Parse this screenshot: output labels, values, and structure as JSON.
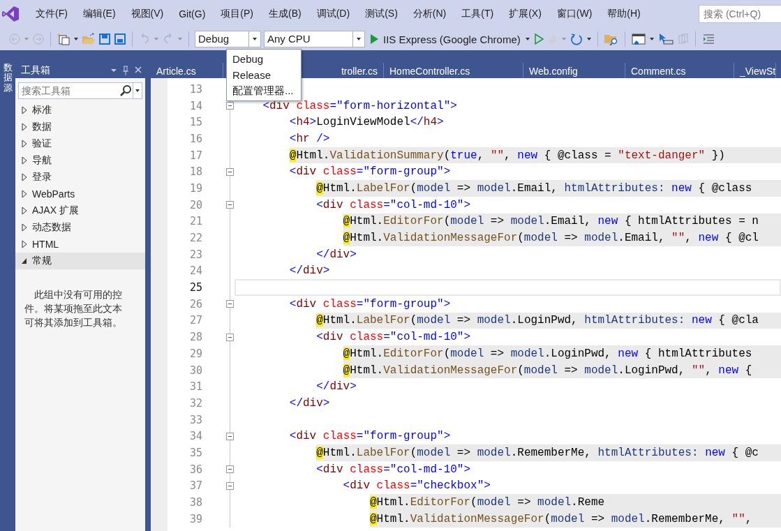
{
  "menu_bar": {
    "items": [
      "文件(F)",
      "编辑(E)",
      "视图(V)",
      "Git(G)",
      "项目(P)",
      "生成(B)",
      "调试(D)",
      "测试(S)",
      "分析(N)",
      "工具(T)",
      "扩展(X)",
      "窗口(W)",
      "帮助(H)"
    ],
    "search": {
      "placeholder": "搜索 (Ctrl+Q)"
    }
  },
  "toolbar": {
    "config_combo": {
      "value": "Debug"
    },
    "platform_combo": {
      "value": "Any CPU"
    },
    "run_button": {
      "label": "IIS Express (Google Chrome)"
    }
  },
  "config_menu": {
    "items": [
      "Debug",
      "Release",
      "配置管理器..."
    ]
  },
  "side_tab": {
    "label": "数据源"
  },
  "toolbox": {
    "title": "工具箱",
    "search": {
      "placeholder": "搜索工具箱"
    },
    "groups": [
      {
        "label": "标准",
        "expanded": false,
        "selected": false
      },
      {
        "label": "数据",
        "expanded": false,
        "selected": false
      },
      {
        "label": "验证",
        "expanded": false,
        "selected": false
      },
      {
        "label": "导航",
        "expanded": false,
        "selected": false
      },
      {
        "label": "登录",
        "expanded": false,
        "selected": false
      },
      {
        "label": "WebParts",
        "expanded": false,
        "selected": false
      },
      {
        "label": "AJAX 扩展",
        "expanded": false,
        "selected": false
      },
      {
        "label": "动态数据",
        "expanded": false,
        "selected": false
      },
      {
        "label": "HTML",
        "expanded": false,
        "selected": false
      },
      {
        "label": "常规",
        "expanded": true,
        "selected": true
      }
    ],
    "empty_note": "此组中没有可用的控件。将某项拖至此文本可将其添加到工具箱。"
  },
  "tabs": [
    "Article.cs",
    "troller.cs",
    "HomeController.cs",
    "Web.config",
    "Comment.cs",
    "_ViewSt"
  ],
  "editor": {
    "lines": [
      {
        "number": "13",
        "fold": false,
        "current": false
      },
      {
        "number": "14",
        "fold": true,
        "current": false,
        "razor": false,
        "tokens": [
          {
            "kind": "punct",
            "text": "<"
          },
          {
            "kind": "tag",
            "text": "div"
          },
          {
            "kind": "attr",
            "text": " class"
          },
          {
            "kind": "punct",
            "text": "="
          },
          {
            "kind": "value",
            "text": "\"form-horizontal\""
          },
          {
            "kind": "punct",
            "text": ">"
          }
        ],
        "children": [
          {
            "number": "15",
            "fold": false,
            "current": false,
            "razor": false,
            "tokens": [
              {
                "kind": "punct",
                "text": "<"
              },
              {
                "kind": "tag",
                "text": "h4"
              },
              {
                "kind": "punct",
                "text": ">"
              },
              {
                "kind": "text",
                "text": "LoginViewModel"
              },
              {
                "kind": "punct",
                "text": "</"
              },
              {
                "kind": "tag",
                "text": "h4"
              },
              {
                "kind": "punct",
                "text": ">"
              }
            ]
          },
          {
            "number": "16",
            "fold": false,
            "current": false,
            "razor": false,
            "tokens": [
              {
                "kind": "punct",
                "text": "<"
              },
              {
                "kind": "tag",
                "text": "hr"
              },
              {
                "kind": "punct",
                "text": " />"
              }
            ]
          },
          {
            "number": "17",
            "fold": false,
            "current": false,
            "razor": true,
            "tokens": [
              {
                "kind": "at",
                "text": "@"
              },
              {
                "kind": "text",
                "text": "Html."
              },
              {
                "kind": "method",
                "text": "ValidationSummary"
              },
              {
                "kind": "text",
                "text": "("
              },
              {
                "kind": "kw",
                "text": "true"
              },
              {
                "kind": "text",
                "text": ", "
              },
              {
                "kind": "str",
                "text": "\"\""
              },
              {
                "kind": "text",
                "text": ", "
              },
              {
                "kind": "kw",
                "text": "new"
              },
              {
                "kind": "text",
                "text": " { @class = "
              },
              {
                "kind": "str",
                "text": "\"text-danger\""
              },
              {
                "kind": "text",
                "text": " })"
              }
            ]
          },
          {
            "number": "18",
            "fold": true,
            "current": false,
            "razor": false,
            "tokens": [
              {
                "kind": "punct",
                "text": "<"
              },
              {
                "kind": "tag",
                "text": "div"
              },
              {
                "kind": "attr",
                "text": " class"
              },
              {
                "kind": "punct",
                "text": "="
              },
              {
                "kind": "value",
                "text": "\"form-group\""
              },
              {
                "kind": "punct",
                "text": ">"
              }
            ],
            "children": [
              {
                "number": "19",
                "fold": false,
                "current": false,
                "razor": true,
                "tokens": [
                  {
                    "kind": "at",
                    "text": "@"
                  },
                  {
                    "kind": "text",
                    "text": "Html."
                  },
                  {
                    "kind": "method",
                    "text": "LabelFor"
                  },
                  {
                    "kind": "text",
                    "text": "("
                  },
                  {
                    "kind": "var",
                    "text": "model"
                  },
                  {
                    "kind": "text",
                    "text": " => "
                  },
                  {
                    "kind": "var",
                    "text": "model"
                  },
                  {
                    "kind": "text",
                    "text": ".Email, "
                  },
                  {
                    "kind": "var",
                    "text": "htmlAttributes:"
                  },
                  {
                    "kind": "kw",
                    "text": " new"
                  },
                  {
                    "kind": "text",
                    "text": " { @class"
                  }
                ]
              },
              {
                "number": "20",
                "fold": true,
                "current": false,
                "razor": false,
                "tokens": [
                  {
                    "kind": "punct",
                    "text": "<"
                  },
                  {
                    "kind": "tag",
                    "text": "div"
                  },
                  {
                    "kind": "attr",
                    "text": " class"
                  },
                  {
                    "kind": "punct",
                    "text": "="
                  },
                  {
                    "kind": "value",
                    "text": "\"col-md-10\""
                  },
                  {
                    "kind": "punct",
                    "text": ">"
                  }
                ],
                "children": [
                  {
                    "number": "21",
                    "fold": false,
                    "current": false,
                    "razor": true,
                    "tokens": [
                      {
                        "kind": "at",
                        "text": "@"
                      },
                      {
                        "kind": "text",
                        "text": "Html."
                      },
                      {
                        "kind": "method",
                        "text": "EditorFor"
                      },
                      {
                        "kind": "text",
                        "text": "("
                      },
                      {
                        "kind": "var",
                        "text": "model"
                      },
                      {
                        "kind": "text",
                        "text": " => "
                      },
                      {
                        "kind": "var",
                        "text": "model"
                      },
                      {
                        "kind": "text",
                        "text": ".Email, "
                      },
                      {
                        "kind": "kw",
                        "text": "new"
                      },
                      {
                        "kind": "text",
                        "text": " { htmlAttributes = n"
                      }
                    ]
                  },
                  {
                    "number": "22",
                    "fold": false,
                    "current": false,
                    "razor": true,
                    "tokens": [
                      {
                        "kind": "at",
                        "text": "@"
                      },
                      {
                        "kind": "text",
                        "text": "Html."
                      },
                      {
                        "kind": "method",
                        "text": "ValidationMessageFor"
                      },
                      {
                        "kind": "text",
                        "text": "("
                      },
                      {
                        "kind": "var",
                        "text": "model"
                      },
                      {
                        "kind": "text",
                        "text": " => "
                      },
                      {
                        "kind": "var",
                        "text": "model"
                      },
                      {
                        "kind": "text",
                        "text": ".Email, "
                      },
                      {
                        "kind": "str",
                        "text": "\"\""
                      },
                      {
                        "kind": "text",
                        "text": ", "
                      },
                      {
                        "kind": "kw",
                        "text": "new"
                      },
                      {
                        "kind": "text",
                        "text": " { @cl"
                      }
                    ]
                  }
                ]
              },
              {
                "number": "23",
                "fold": false,
                "current": false,
                "razor": false,
                "tokens": [
                  {
                    "kind": "punct",
                    "text": "</"
                  },
                  {
                    "kind": "tag",
                    "text": "div"
                  },
                  {
                    "kind": "punct",
                    "text": ">"
                  }
                ]
              }
            ]
          },
          {
            "number": "24",
            "fold": false,
            "current": false,
            "razor": false,
            "tokens": [
              {
                "kind": "punct",
                "text": "</"
              },
              {
                "kind": "tag",
                "text": "div"
              },
              {
                "kind": "punct",
                "text": ">"
              }
            ]
          },
          {
            "number": "25",
            "fold": false,
            "current": true
          },
          {
            "number": "26",
            "fold": true,
            "current": false,
            "razor": false,
            "tokens": [
              {
                "kind": "punct",
                "text": "<"
              },
              {
                "kind": "tag",
                "text": "div"
              },
              {
                "kind": "attr",
                "text": " class"
              },
              {
                "kind": "punct",
                "text": "="
              },
              {
                "kind": "value",
                "text": "\"form-group\""
              },
              {
                "kind": "punct",
                "text": ">"
              }
            ],
            "children": [
              {
                "number": "27",
                "fold": false,
                "current": false,
                "razor": true,
                "tokens": [
                  {
                    "kind": "at",
                    "text": "@"
                  },
                  {
                    "kind": "text",
                    "text": "Html."
                  },
                  {
                    "kind": "method",
                    "text": "LabelFor"
                  },
                  {
                    "kind": "text",
                    "text": "("
                  },
                  {
                    "kind": "var",
                    "text": "model"
                  },
                  {
                    "kind": "text",
                    "text": " => "
                  },
                  {
                    "kind": "var",
                    "text": "model"
                  },
                  {
                    "kind": "text",
                    "text": ".LoginPwd, "
                  },
                  {
                    "kind": "var",
                    "text": "htmlAttributes:"
                  },
                  {
                    "kind": "kw",
                    "text": " new"
                  },
                  {
                    "kind": "text",
                    "text": " { @cla"
                  }
                ]
              },
              {
                "number": "28",
                "fold": true,
                "current": false,
                "razor": false,
                "tokens": [
                  {
                    "kind": "punct",
                    "text": "<"
                  },
                  {
                    "kind": "tag",
                    "text": "div"
                  },
                  {
                    "kind": "attr",
                    "text": " class"
                  },
                  {
                    "kind": "punct",
                    "text": "="
                  },
                  {
                    "kind": "value",
                    "text": "\"col-md-10\""
                  },
                  {
                    "kind": "punct",
                    "text": ">"
                  }
                ],
                "children": [
                  {
                    "number": "29",
                    "fold": false,
                    "current": false,
                    "razor": true,
                    "tokens": [
                      {
                        "kind": "at",
                        "text": "@"
                      },
                      {
                        "kind": "text",
                        "text": "Html."
                      },
                      {
                        "kind": "method",
                        "text": "EditorFor"
                      },
                      {
                        "kind": "text",
                        "text": "("
                      },
                      {
                        "kind": "var",
                        "text": "model"
                      },
                      {
                        "kind": "text",
                        "text": " => "
                      },
                      {
                        "kind": "var",
                        "text": "model"
                      },
                      {
                        "kind": "text",
                        "text": ".LoginPwd, "
                      },
                      {
                        "kind": "kw",
                        "text": "new"
                      },
                      {
                        "kind": "text",
                        "text": " { htmlAttributes"
                      }
                    ]
                  },
                  {
                    "number": "30",
                    "fold": false,
                    "current": false,
                    "razor": true,
                    "tokens": [
                      {
                        "kind": "at",
                        "text": "@"
                      },
                      {
                        "kind": "text",
                        "text": "Html."
                      },
                      {
                        "kind": "method",
                        "text": "ValidationMessageFor"
                      },
                      {
                        "kind": "text",
                        "text": "("
                      },
                      {
                        "kind": "var",
                        "text": "model"
                      },
                      {
                        "kind": "text",
                        "text": " => "
                      },
                      {
                        "kind": "var",
                        "text": "model"
                      },
                      {
                        "kind": "text",
                        "text": ".LoginPwd, "
                      },
                      {
                        "kind": "str",
                        "text": "\"\""
                      },
                      {
                        "kind": "text",
                        "text": ", "
                      },
                      {
                        "kind": "kw",
                        "text": "new"
                      },
                      {
                        "kind": "text",
                        "text": " {"
                      }
                    ]
                  }
                ]
              },
              {
                "number": "31",
                "fold": false,
                "current": false,
                "razor": false,
                "tokens": [
                  {
                    "kind": "punct",
                    "text": "</"
                  },
                  {
                    "kind": "tag",
                    "text": "div"
                  },
                  {
                    "kind": "punct",
                    "text": ">"
                  }
                ]
              }
            ]
          },
          {
            "number": "32",
            "fold": false,
            "current": false,
            "razor": false,
            "tokens": [
              {
                "kind": "punct",
                "text": "</"
              },
              {
                "kind": "tag",
                "text": "div"
              },
              {
                "kind": "punct",
                "text": ">"
              }
            ]
          },
          {
            "number": "33",
            "fold": false,
            "current": false
          },
          {
            "number": "34",
            "fold": true,
            "current": false,
            "razor": false,
            "tokens": [
              {
                "kind": "punct",
                "text": "<"
              },
              {
                "kind": "tag",
                "text": "div"
              },
              {
                "kind": "attr",
                "text": " class"
              },
              {
                "kind": "punct",
                "text": "="
              },
              {
                "kind": "value",
                "text": "\"form-group\""
              },
              {
                "kind": "punct",
                "text": ">"
              }
            ],
            "children": [
              {
                "number": "35",
                "fold": false,
                "current": false,
                "razor": true,
                "tokens": [
                  {
                    "kind": "at",
                    "text": "@"
                  },
                  {
                    "kind": "text",
                    "text": "Html."
                  },
                  {
                    "kind": "method",
                    "text": "LabelFor"
                  },
                  {
                    "kind": "text",
                    "text": "("
                  },
                  {
                    "kind": "var",
                    "text": "model"
                  },
                  {
                    "kind": "text",
                    "text": " => "
                  },
                  {
                    "kind": "var",
                    "text": "model"
                  },
                  {
                    "kind": "text",
                    "text": ".RememberMe, "
                  },
                  {
                    "kind": "var",
                    "text": "htmlAttributes:"
                  },
                  {
                    "kind": "kw",
                    "text": " new"
                  },
                  {
                    "kind": "text",
                    "text": " { @c"
                  }
                ]
              },
              {
                "number": "36",
                "fold": true,
                "current": false,
                "razor": false,
                "tokens": [
                  {
                    "kind": "punct",
                    "text": "<"
                  },
                  {
                    "kind": "tag",
                    "text": "div"
                  },
                  {
                    "kind": "attr",
                    "text": " class"
                  },
                  {
                    "kind": "punct",
                    "text": "="
                  },
                  {
                    "kind": "value",
                    "text": "\"col-md-10\""
                  },
                  {
                    "kind": "punct",
                    "text": ">"
                  }
                ],
                "children": [
                  {
                    "number": "37",
                    "fold": true,
                    "current": false,
                    "razor": false,
                    "tokens": [
                      {
                        "kind": "punct",
                        "text": "<"
                      },
                      {
                        "kind": "tag",
                        "text": "div"
                      },
                      {
                        "kind": "attr",
                        "text": " class"
                      },
                      {
                        "kind": "punct",
                        "text": "="
                      },
                      {
                        "kind": "value",
                        "text": "\"checkbox\""
                      },
                      {
                        "kind": "punct",
                        "text": ">"
                      }
                    ],
                    "children": [
                      {
                        "number": "38",
                        "fold": false,
                        "current": false,
                        "razor": true,
                        "tokens": [
                          {
                            "kind": "at",
                            "text": "@"
                          },
                          {
                            "kind": "text",
                            "text": "Html."
                          },
                          {
                            "kind": "method",
                            "text": "EditorFor"
                          },
                          {
                            "kind": "text",
                            "text": "("
                          },
                          {
                            "kind": "var",
                            "text": "model"
                          },
                          {
                            "kind": "text",
                            "text": " => "
                          },
                          {
                            "kind": "var",
                            "text": "model"
                          },
                          {
                            "kind": "text",
                            "text": ".Reme"
                          }
                        ]
                      },
                      {
                        "number": "39",
                        "fold": false,
                        "current": false,
                        "razor": true,
                        "tokens": [
                          {
                            "kind": "at",
                            "text": "@"
                          },
                          {
                            "kind": "text",
                            "text": "Html."
                          },
                          {
                            "kind": "method",
                            "text": "ValidationMessageFor"
                          },
                          {
                            "kind": "text",
                            "text": "("
                          },
                          {
                            "kind": "var",
                            "text": "model"
                          },
                          {
                            "kind": "text",
                            "text": " => "
                          },
                          {
                            "kind": "var",
                            "text": "model"
                          },
                          {
                            "kind": "text",
                            "text": ".RememberMe, "
                          },
                          {
                            "kind": "str",
                            "text": "\"\""
                          },
                          {
                            "kind": "text",
                            "text": ","
                          }
                        ]
                      }
                    ]
                  }
                ]
              }
            ]
          }
        ]
      }
    ]
  }
}
